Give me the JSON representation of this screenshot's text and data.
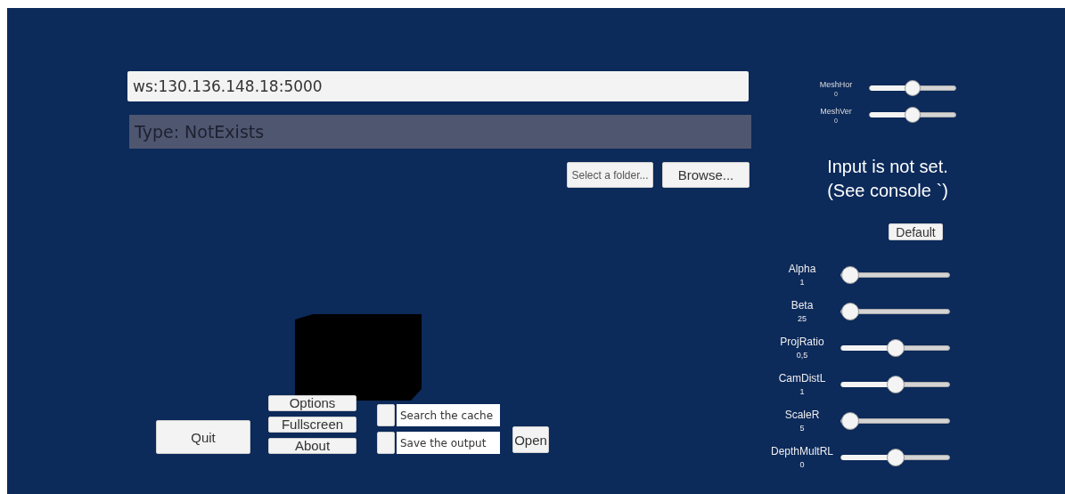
{
  "address_field": {
    "value": "ws:130.136.148.18:5000"
  },
  "type_label": "Type: NotExists",
  "folder": {
    "placeholder": "Select a folder...",
    "browse": "Browse..."
  },
  "buttons": {
    "quit": "Quit",
    "menu": [
      "Options",
      "Fullscreen",
      "About"
    ],
    "open": "Open"
  },
  "checkboxes": [
    {
      "label": "Search the cache",
      "checked": false
    },
    {
      "label": "Save the output",
      "checked": false
    }
  ],
  "mesh_sliders": [
    {
      "label": "MeshHor",
      "reading": "0",
      "level": 0.5
    },
    {
      "label": "MeshVer",
      "reading": "0",
      "level": 0.5
    }
  ],
  "status_message": [
    "Input is not set.",
    "(See console `)"
  ],
  "default_button": "Default",
  "sliders": [
    {
      "label": "Alpha",
      "reading": "1",
      "level": 0
    },
    {
      "label": "Beta",
      "reading": "25",
      "level": 0
    },
    {
      "label": "ProjRatio",
      "reading": "0,5",
      "level": 0.5
    },
    {
      "label": "CamDistL",
      "reading": "1",
      "level": 0.5
    },
    {
      "label": "ScaleR",
      "reading": "5",
      "level": 0
    },
    {
      "label": "DepthMultRL",
      "reading": "0",
      "level": 0.5
    }
  ]
}
